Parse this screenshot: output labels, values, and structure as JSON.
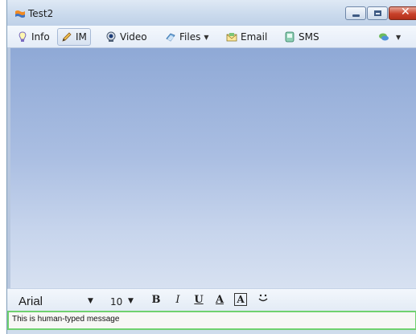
{
  "window": {
    "title": "Test2"
  },
  "toolbar": {
    "items": [
      {
        "label": "Info",
        "icon": "lightbulb-icon"
      },
      {
        "label": "IM",
        "icon": "pencil-icon"
      },
      {
        "label": "Video",
        "icon": "webcam-icon"
      },
      {
        "label": "Files",
        "icon": "files-icon",
        "has_dropdown": true
      },
      {
        "label": "Email",
        "icon": "email-icon"
      },
      {
        "label": "SMS",
        "icon": "sms-icon"
      }
    ],
    "active_item": "IM",
    "extra_icon": "chat-bubbles-icon"
  },
  "format_bar": {
    "font": "Arial",
    "size": "10",
    "bold_glyph": "B",
    "italic_glyph": "I",
    "underline_glyph": "U",
    "text_color_glyph": "A",
    "background_color_glyph": "A",
    "emoticon_glyph": "̫"
  },
  "message_input": {
    "value": "This is human-typed message"
  },
  "colors": {
    "accent_green": "#6fd16f",
    "chat_background_top": "#8fa9d6",
    "chat_background_bottom": "#d7e1f1",
    "close_button": "#c8412a"
  }
}
